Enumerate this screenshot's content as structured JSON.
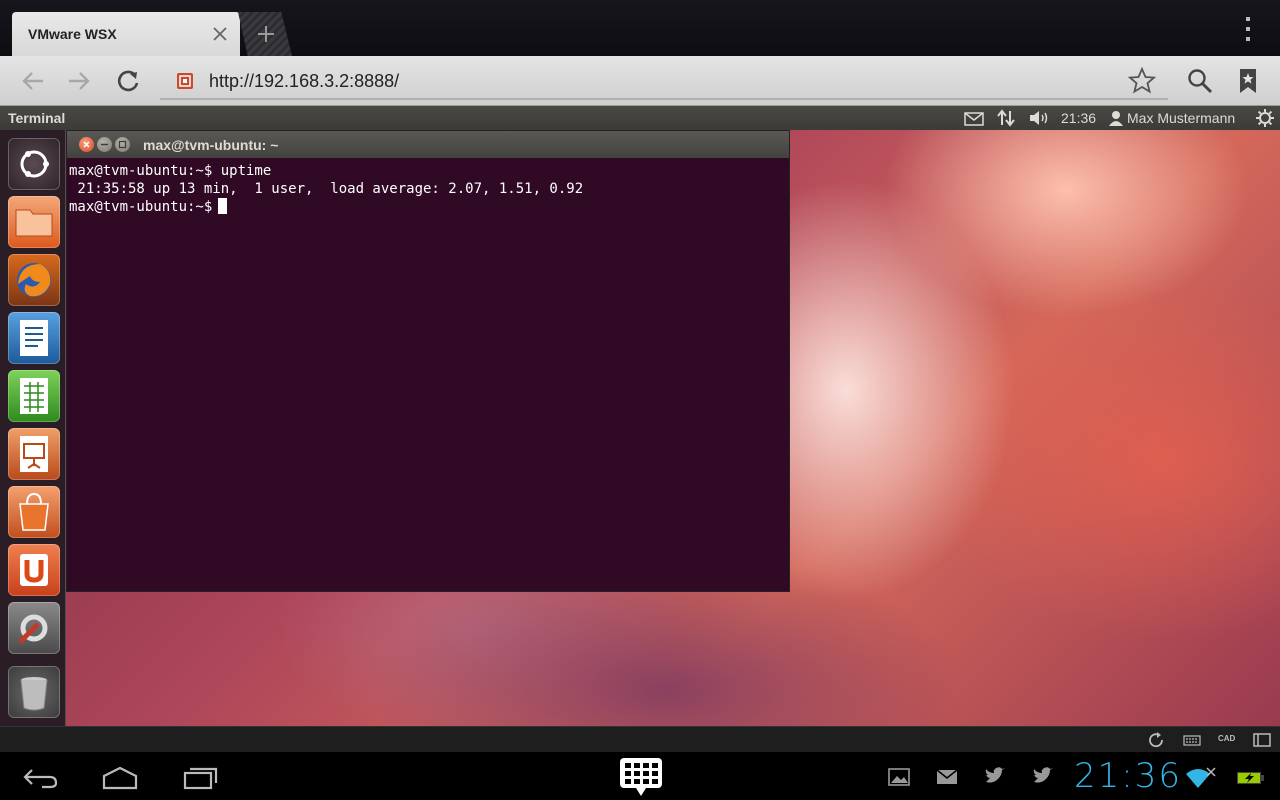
{
  "browser": {
    "tab_title": "VMware WSX",
    "url": "http://192.168.3.2:8888/"
  },
  "remote": {
    "app_title": "Terminal",
    "time": "21:36",
    "user": "Max Mustermann",
    "launcher": [
      "dash-home-icon",
      "files-icon",
      "firefox-icon",
      "writer-icon",
      "calc-icon",
      "impress-icon",
      "software-center-icon",
      "ubuntu-one-icon",
      "system-settings-icon",
      "trash-icon"
    ]
  },
  "terminal": {
    "title": "max@tvm-ubuntu: ~",
    "lines": [
      "max@tvm-ubuntu:~$ uptime",
      " 21:35:58 up 13 min,  1 user,  load average: 2.07, 1.51, 0.92",
      "max@tvm-ubuntu:~$"
    ]
  },
  "vmbar": {
    "cad_label": "CAD"
  },
  "android": {
    "clock": "21:36"
  },
  "colors": {
    "terminal_bg": "#300a24",
    "clock": "#33b5e5",
    "ubuntu_orange": "#dd4814"
  }
}
